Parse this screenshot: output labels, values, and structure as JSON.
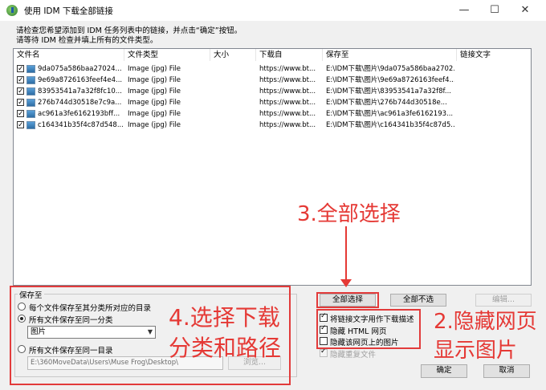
{
  "window": {
    "title": "使用 IDM 下载全部链接",
    "controls": {
      "minimize": "—",
      "maximize": "☐",
      "close": "✕"
    }
  },
  "instructions": {
    "line1": "请检查您希望添加到 IDM 任务列表中的链接，并点击“确定”按钮。",
    "line2": "请等待 IDM 检查并填上所有的文件类型。"
  },
  "table": {
    "headers": [
      "文件名",
      "文件类型",
      "大小",
      "下载自",
      "保存至",
      "链接文字"
    ],
    "rows": [
      {
        "filename": "9da075a586baa27024...",
        "type": "Image (jpg) File",
        "size": "",
        "from": "https://www.bt...",
        "saveto": "E:\\IDM下载\\图片\\9da075a586baa2702...",
        "linktext": ""
      },
      {
        "filename": "9e69a8726163feef4e4...",
        "type": "Image (jpg) File",
        "size": "",
        "from": "https://www.bt...",
        "saveto": "E:\\IDM下载\\图片\\9e69a8726163feef4...",
        "linktext": ""
      },
      {
        "filename": "83953541a7a32f8fc10...",
        "type": "Image (jpg) File",
        "size": "",
        "from": "https://www.bt...",
        "saveto": "E:\\IDM下载\\图片\\83953541a7a32f8f...",
        "linktext": ""
      },
      {
        "filename": "276b744d30518e7c9a...",
        "type": "Image (jpg) File",
        "size": "",
        "from": "https://www.bt...",
        "saveto": "E:\\IDM下载\\图片\\276b744d30518e...",
        "linktext": ""
      },
      {
        "filename": "ac961a3fe6162193bff...",
        "type": "Image (jpg) File",
        "size": "",
        "from": "https://www.bt...",
        "saveto": "E:\\IDM下载\\图片\\ac961a3fe6162193...",
        "linktext": ""
      },
      {
        "filename": "c164341b35f4c87d548...",
        "type": "Image (jpg) File",
        "size": "",
        "from": "https://www.bt...",
        "saveto": "E:\\IDM下载\\图片\\c164341b35f4c87d5...",
        "linktext": ""
      }
    ]
  },
  "save": {
    "group_title": "保存至",
    "option1": "每个文件保存至其分类所对应的目录",
    "option2": "所有文件保存至同一分类",
    "category": "图片",
    "option3": "所有文件保存至同一目录",
    "path": "E:\\360MoveData\\Users\\Muse Frog\\Desktop\\",
    "browse": "浏览..."
  },
  "buttons": {
    "select_all": "全部选择",
    "deselect_all": "全部不选",
    "edit": "编辑...",
    "ok": "确定",
    "cancel": "取消"
  },
  "checkboxes": {
    "use_link_text": "将链接文字用作下载描述",
    "hide_html": "隐藏 HTML 网页",
    "hide_images": "隐藏该网页上的图片",
    "hide_duplicates": "隐藏重复文件"
  },
  "annotations": {
    "a3": "3.全部选择",
    "a4_line1": "4.选择下载",
    "a4_line2": "分类和路径",
    "a2_line1": "2.隐藏网页",
    "a2_line2": "显示图片"
  },
  "colors": {
    "annotation_red": "#e53935",
    "window_bg": "#f0f0f0"
  }
}
